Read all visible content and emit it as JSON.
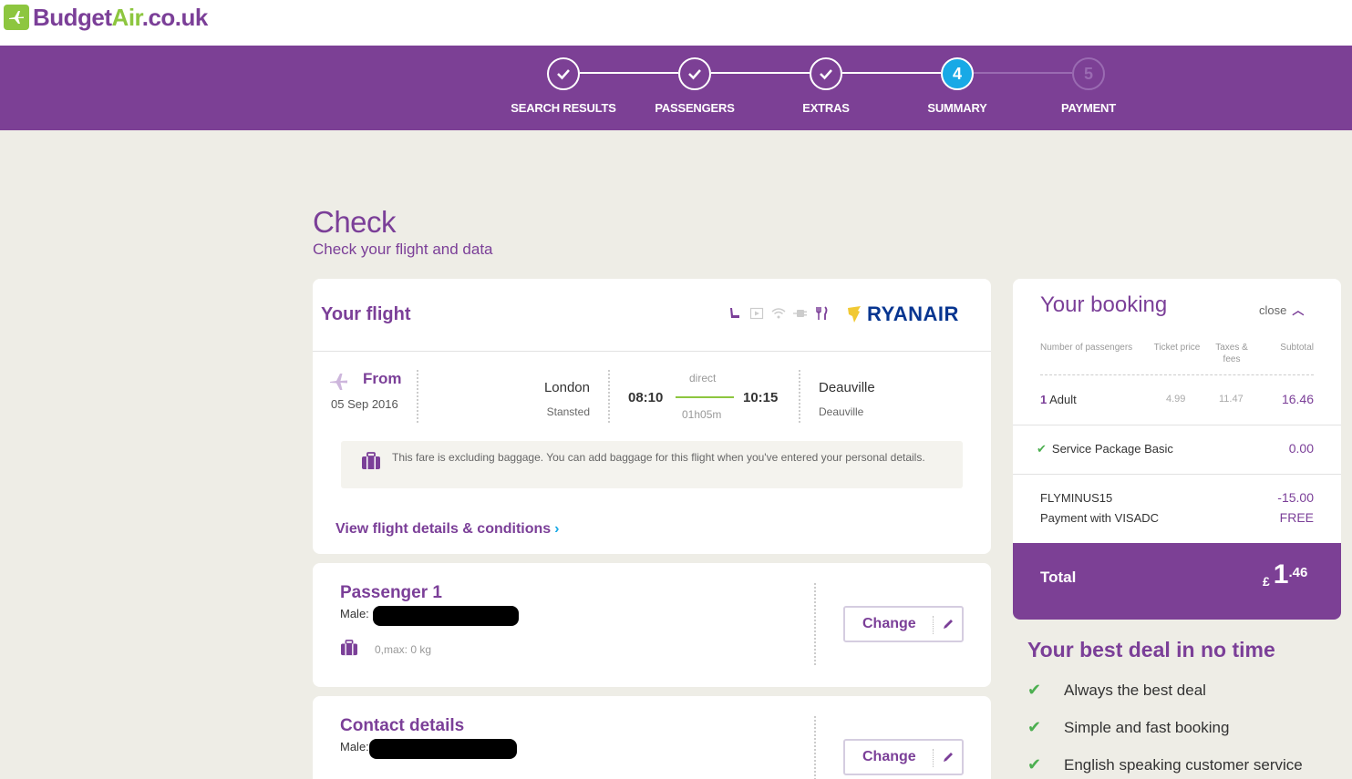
{
  "brand": {
    "part1": "Budget",
    "part2": "Air",
    "part3": ".co.uk"
  },
  "steps": [
    {
      "label": "SEARCH RESULTS",
      "state": "done"
    },
    {
      "label": "PASSENGERS",
      "state": "done"
    },
    {
      "label": "EXTRAS",
      "state": "done"
    },
    {
      "label": "SUMMARY",
      "state": "active",
      "number": "4"
    },
    {
      "label": "PAYMENT",
      "state": "future",
      "number": "5"
    }
  ],
  "page": {
    "title": "Check",
    "subtitle": "Check your flight and data"
  },
  "flight": {
    "header_title": "Your flight",
    "airline": "RYANAIR",
    "from_label": "From",
    "date": "05 Sep 2016",
    "origin_city": "London",
    "origin_airport": "Stansted",
    "depart_time": "08:10",
    "stop_type": "direct",
    "duration": "01h05m",
    "arrive_time": "10:15",
    "dest_city": "Deauville",
    "dest_airport": "Deauville",
    "baggage_note": "This fare is excluding baggage. You can add baggage for this flight when you've entered your personal details.",
    "details_link": "View flight details & conditions"
  },
  "passenger": {
    "title": "Passenger 1",
    "gender_label": "Male:",
    "baggage": "0,max: 0 kg",
    "change_label": "Change"
  },
  "contact": {
    "title": "Contact details",
    "gender_label": "Male:",
    "change_label": "Change"
  },
  "booking": {
    "title": "Your booking",
    "close_label": "close",
    "headers": {
      "pax": "Number of passengers",
      "ticket": "Ticket price",
      "taxes": "Taxes & fees",
      "subtotal": "Subtotal"
    },
    "adult_count": "1",
    "adult_label": "Adult",
    "ticket_price": "4.99",
    "taxes": "11.47",
    "adult_subtotal": "16.46",
    "service_label": "Service Package Basic",
    "service_value": "0.00",
    "promo_label": "FLYMINUS15",
    "promo_value": "-15.00",
    "payment_label": "Payment with VISADC",
    "payment_value": "FREE",
    "total_label": "Total",
    "currency": "£",
    "total_int": "1",
    "total_dec": ".46"
  },
  "deal": {
    "title": "Your best deal in no time",
    "items": [
      "Always the best deal",
      "Simple and fast booking",
      "English speaking customer service"
    ]
  },
  "colors": {
    "brand_purple": "#7c4095",
    "brand_green": "#8dc63f",
    "active_blue": "#18a9e6",
    "ryanair_blue": "#073590"
  }
}
